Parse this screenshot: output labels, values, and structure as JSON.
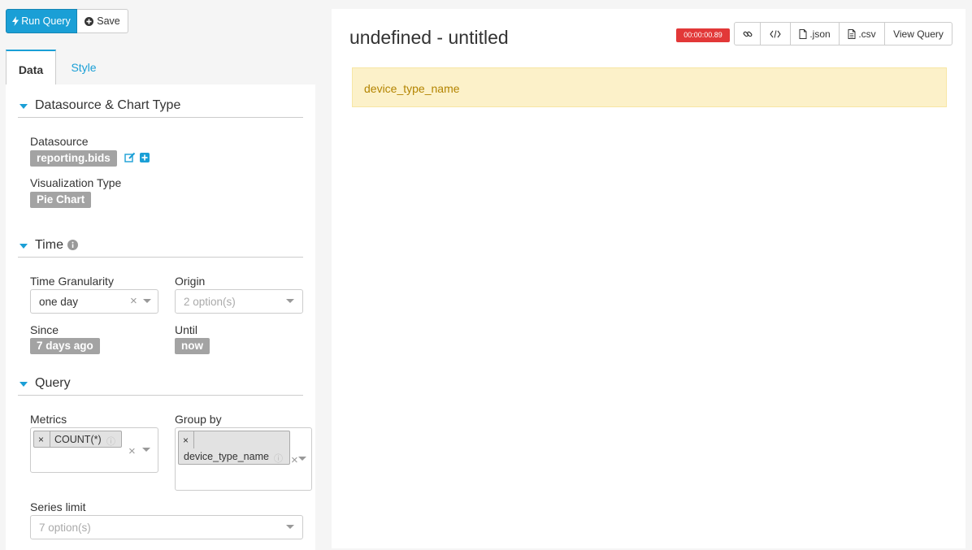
{
  "toolbar": {
    "run_label": "Run Query",
    "save_label": "Save"
  },
  "tabs": [
    {
      "label": "Data",
      "active": true
    },
    {
      "label": "Style",
      "active": false
    }
  ],
  "sections": {
    "datasource": {
      "title": "Datasource & Chart Type",
      "datasource_label": "Datasource",
      "datasource_value": "reporting.bids",
      "viz_label": "Visualization Type",
      "viz_value": "Pie Chart"
    },
    "time": {
      "title": "Time",
      "granularity_label": "Time Granularity",
      "granularity_value": "one day",
      "origin_label": "Origin",
      "origin_placeholder": "2 option(s)",
      "since_label": "Since",
      "since_value": "7 days ago",
      "until_label": "Until",
      "until_value": "now"
    },
    "query": {
      "title": "Query",
      "metrics_label": "Metrics",
      "metrics": [
        "COUNT(*)"
      ],
      "groupby_label": "Group by",
      "groupby": [
        "device_type_name"
      ],
      "series_limit_label": "Series limit",
      "series_limit_placeholder": "7 option(s)"
    }
  },
  "result": {
    "title": "undefined - untitled",
    "timer": "00:00:00.89",
    "actions": [
      {
        "label": "",
        "icon": "link-icon"
      },
      {
        "label": "",
        "icon": "code-icon"
      },
      {
        "label": ".json",
        "icon": "file-icon"
      },
      {
        "label": ".csv",
        "icon": "file-icon"
      },
      {
        "label": "View Query",
        "icon": ""
      }
    ],
    "alert": "device_type_name"
  },
  "colors": {
    "accent": "#1a9fd6",
    "tag_gray": "#a3a3a3",
    "timer_red": "#e23838",
    "alert_bg": "#fcf1c9",
    "alert_text": "#b38400"
  }
}
